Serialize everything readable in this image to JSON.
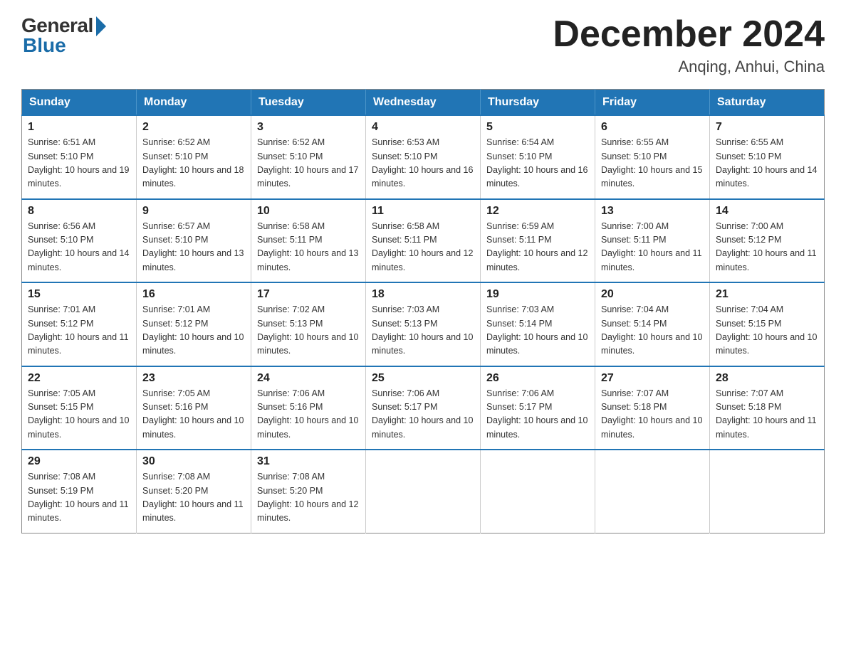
{
  "header": {
    "logo_general": "General",
    "logo_blue": "Blue",
    "month_year": "December 2024",
    "location": "Anqing, Anhui, China"
  },
  "weekdays": [
    "Sunday",
    "Monday",
    "Tuesday",
    "Wednesday",
    "Thursday",
    "Friday",
    "Saturday"
  ],
  "weeks": [
    [
      {
        "day": "1",
        "sunrise": "6:51 AM",
        "sunset": "5:10 PM",
        "daylight": "10 hours and 19 minutes."
      },
      {
        "day": "2",
        "sunrise": "6:52 AM",
        "sunset": "5:10 PM",
        "daylight": "10 hours and 18 minutes."
      },
      {
        "day": "3",
        "sunrise": "6:52 AM",
        "sunset": "5:10 PM",
        "daylight": "10 hours and 17 minutes."
      },
      {
        "day": "4",
        "sunrise": "6:53 AM",
        "sunset": "5:10 PM",
        "daylight": "10 hours and 16 minutes."
      },
      {
        "day": "5",
        "sunrise": "6:54 AM",
        "sunset": "5:10 PM",
        "daylight": "10 hours and 16 minutes."
      },
      {
        "day": "6",
        "sunrise": "6:55 AM",
        "sunset": "5:10 PM",
        "daylight": "10 hours and 15 minutes."
      },
      {
        "day": "7",
        "sunrise": "6:55 AM",
        "sunset": "5:10 PM",
        "daylight": "10 hours and 14 minutes."
      }
    ],
    [
      {
        "day": "8",
        "sunrise": "6:56 AM",
        "sunset": "5:10 PM",
        "daylight": "10 hours and 14 minutes."
      },
      {
        "day": "9",
        "sunrise": "6:57 AM",
        "sunset": "5:10 PM",
        "daylight": "10 hours and 13 minutes."
      },
      {
        "day": "10",
        "sunrise": "6:58 AM",
        "sunset": "5:11 PM",
        "daylight": "10 hours and 13 minutes."
      },
      {
        "day": "11",
        "sunrise": "6:58 AM",
        "sunset": "5:11 PM",
        "daylight": "10 hours and 12 minutes."
      },
      {
        "day": "12",
        "sunrise": "6:59 AM",
        "sunset": "5:11 PM",
        "daylight": "10 hours and 12 minutes."
      },
      {
        "day": "13",
        "sunrise": "7:00 AM",
        "sunset": "5:11 PM",
        "daylight": "10 hours and 11 minutes."
      },
      {
        "day": "14",
        "sunrise": "7:00 AM",
        "sunset": "5:12 PM",
        "daylight": "10 hours and 11 minutes."
      }
    ],
    [
      {
        "day": "15",
        "sunrise": "7:01 AM",
        "sunset": "5:12 PM",
        "daylight": "10 hours and 11 minutes."
      },
      {
        "day": "16",
        "sunrise": "7:01 AM",
        "sunset": "5:12 PM",
        "daylight": "10 hours and 10 minutes."
      },
      {
        "day": "17",
        "sunrise": "7:02 AM",
        "sunset": "5:13 PM",
        "daylight": "10 hours and 10 minutes."
      },
      {
        "day": "18",
        "sunrise": "7:03 AM",
        "sunset": "5:13 PM",
        "daylight": "10 hours and 10 minutes."
      },
      {
        "day": "19",
        "sunrise": "7:03 AM",
        "sunset": "5:14 PM",
        "daylight": "10 hours and 10 minutes."
      },
      {
        "day": "20",
        "sunrise": "7:04 AM",
        "sunset": "5:14 PM",
        "daylight": "10 hours and 10 minutes."
      },
      {
        "day": "21",
        "sunrise": "7:04 AM",
        "sunset": "5:15 PM",
        "daylight": "10 hours and 10 minutes."
      }
    ],
    [
      {
        "day": "22",
        "sunrise": "7:05 AM",
        "sunset": "5:15 PM",
        "daylight": "10 hours and 10 minutes."
      },
      {
        "day": "23",
        "sunrise": "7:05 AM",
        "sunset": "5:16 PM",
        "daylight": "10 hours and 10 minutes."
      },
      {
        "day": "24",
        "sunrise": "7:06 AM",
        "sunset": "5:16 PM",
        "daylight": "10 hours and 10 minutes."
      },
      {
        "day": "25",
        "sunrise": "7:06 AM",
        "sunset": "5:17 PM",
        "daylight": "10 hours and 10 minutes."
      },
      {
        "day": "26",
        "sunrise": "7:06 AM",
        "sunset": "5:17 PM",
        "daylight": "10 hours and 10 minutes."
      },
      {
        "day": "27",
        "sunrise": "7:07 AM",
        "sunset": "5:18 PM",
        "daylight": "10 hours and 10 minutes."
      },
      {
        "day": "28",
        "sunrise": "7:07 AM",
        "sunset": "5:18 PM",
        "daylight": "10 hours and 11 minutes."
      }
    ],
    [
      {
        "day": "29",
        "sunrise": "7:08 AM",
        "sunset": "5:19 PM",
        "daylight": "10 hours and 11 minutes."
      },
      {
        "day": "30",
        "sunrise": "7:08 AM",
        "sunset": "5:20 PM",
        "daylight": "10 hours and 11 minutes."
      },
      {
        "day": "31",
        "sunrise": "7:08 AM",
        "sunset": "5:20 PM",
        "daylight": "10 hours and 12 minutes."
      },
      null,
      null,
      null,
      null
    ]
  ]
}
